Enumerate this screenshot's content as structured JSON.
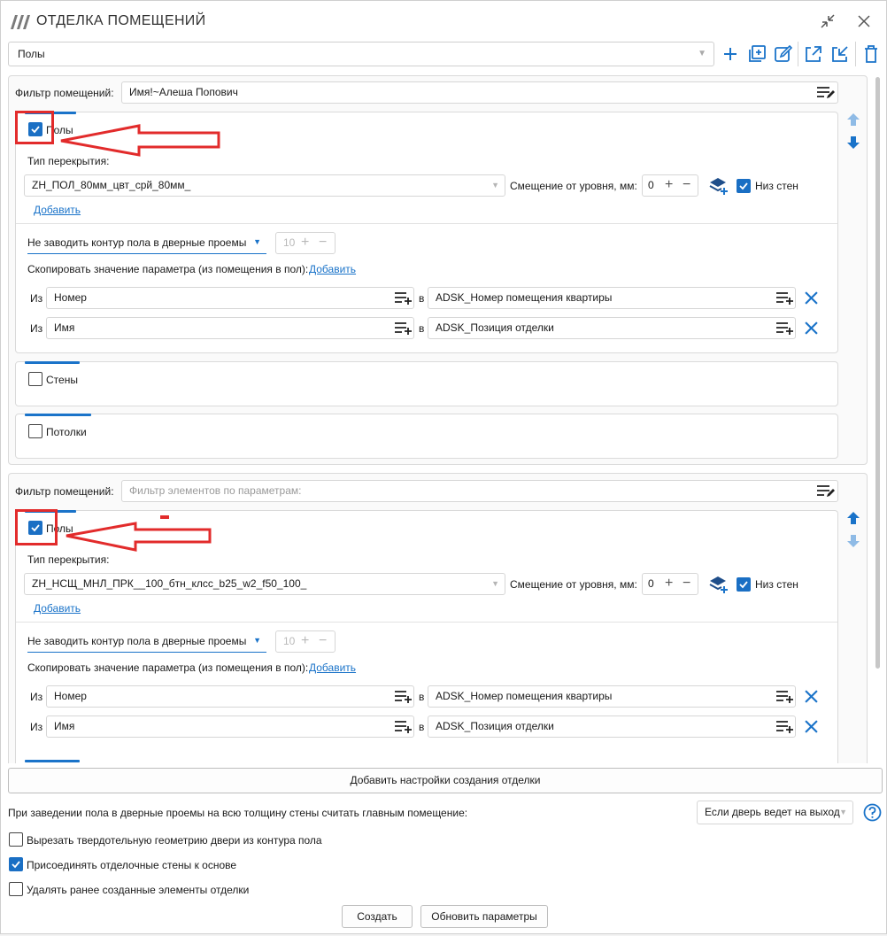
{
  "window": {
    "title": "ОТДЕЛКА ПОМЕЩЕНИЙ",
    "preset_value": "Полы"
  },
  "blocks": [
    {
      "filter_label": "Фильтр помещений:",
      "filter_value": "Имя!~Алеша Попович",
      "floors_label": "Полы",
      "floors_checked": true,
      "overlap_type_label": "Тип перекрытия:",
      "overlap_type_value": "ZH_ПОЛ_80мм_цвт_срй_80мм_",
      "offset_label": "Смещение от уровня, мм:",
      "offset_value": "0",
      "wall_bottom_label": "Низ стен",
      "add_link": "Добавить",
      "door_mode_value": "Не заводить контур пола в дверные проемы",
      "door_depth_value": "10",
      "copy_param_label": "Скопировать значение параметра (из помещения в пол):",
      "copy_add_link": "Добавить",
      "params": [
        {
          "from_label": "Из",
          "from_value": "Номер",
          "to_label": "в",
          "to_value": "ADSK_Номер помещения квартиры"
        },
        {
          "from_label": "Из",
          "from_value": "Имя",
          "to_label": "в",
          "to_value": "ADSK_Позиция отделки"
        }
      ],
      "walls_label": "Стены",
      "ceilings_label": "Потолки"
    },
    {
      "filter_label": "Фильтр помещений:",
      "filter_placeholder": "Фильтр элементов по параметрам:",
      "floors_label": "Полы",
      "floors_checked": true,
      "overlap_type_label": "Тип перекрытия:",
      "overlap_type_value": "ZH_НСЩ_МНЛ_ПРК__100_бтн_клсс_b25_w2_f50_100_",
      "offset_label": "Смещение от уровня, мм:",
      "offset_value": "0",
      "wall_bottom_label": "Низ стен",
      "add_link": "Добавить",
      "door_mode_value": "Не заводить контур пола в дверные проемы",
      "door_depth_value": "10",
      "copy_param_label": "Скопировать значение параметра (из помещения в пол):",
      "copy_add_link": "Добавить",
      "params": [
        {
          "from_label": "Из",
          "from_value": "Номер",
          "to_label": "в",
          "to_value": "ADSK_Номер помещения квартиры"
        },
        {
          "from_label": "Из",
          "from_value": "Имя",
          "to_label": "в",
          "to_value": "ADSK_Позиция отделки"
        }
      ]
    }
  ],
  "footer": {
    "add_settings_button": "Добавить настройки создания отделки",
    "main_room_label": "При заведении пола в дверные проемы на всю толщину стены считать главным помещение:",
    "main_room_value": "Если дверь ведет на выход",
    "options": [
      {
        "label": "Вырезать твердотельную геометрию двери из контура пола",
        "checked": false
      },
      {
        "label": "Присоединять отделочные стены к основе",
        "checked": true
      },
      {
        "label": "Удалять ранее созданные элементы отделки",
        "checked": false
      }
    ],
    "create_button": "Создать",
    "update_button": "Обновить параметры"
  },
  "colors": {
    "accent": "#1a73c9",
    "annotation": "#e22b2b"
  }
}
